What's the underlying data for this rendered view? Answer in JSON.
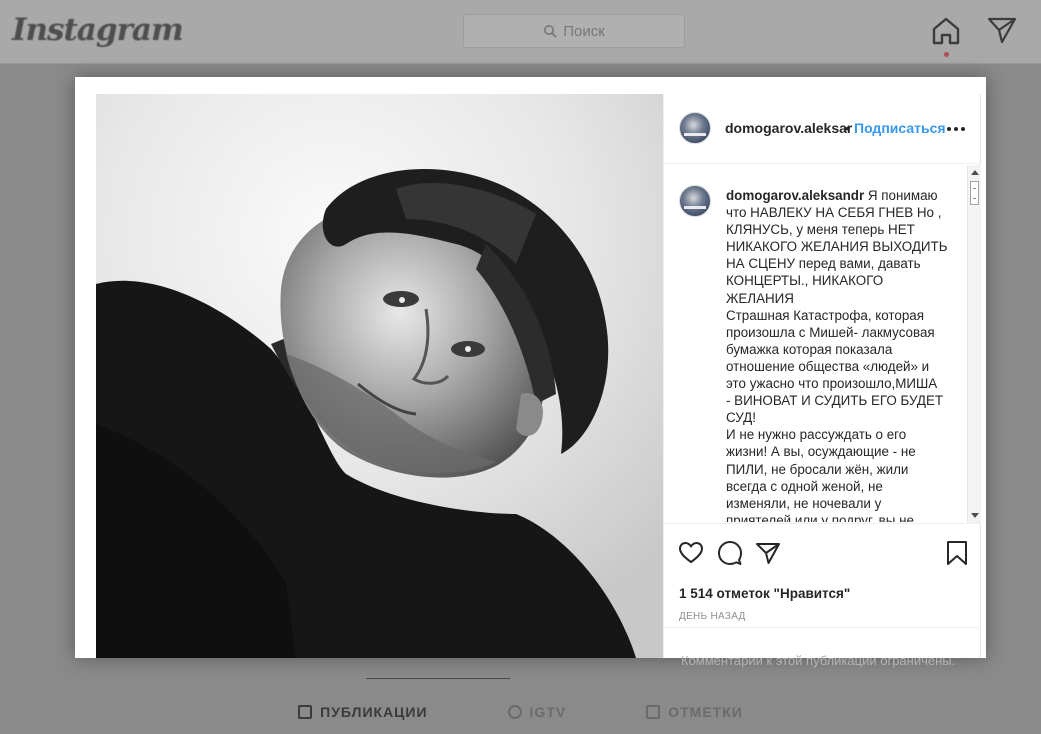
{
  "background": {
    "logo": "Instagram",
    "search_placeholder": "Поиск",
    "tabs": [
      {
        "label": "ПУБЛИКАЦИИ"
      },
      {
        "label": "IGTV"
      },
      {
        "label": "ОТМЕТКИ"
      }
    ]
  },
  "post": {
    "header": {
      "username": "domogarov.aleksar",
      "dot": "•",
      "follow_label": "Подписаться"
    },
    "caption": {
      "username": "domogarov.aleksandr",
      "lines": [
        "Я понимаю",
        "что НАВЛЕКУ НА СЕБЯ ГНЕВ Но ,",
        "КЛЯНУСЬ, у меня теперь НЕТ",
        "НИКАКОГО ЖЕЛАНИЯ ВЫХОДИТЬ",
        "НА СЦЕНУ перед вами, давать",
        "КОНЦЕРТЫ., НИКАКОГО",
        "ЖЕЛАНИЯ",
        "Страшная Катастрофа, которая",
        "произошла с Мишей- лакмусовая",
        "бумажка которая показала",
        "отношение общества «людей» и",
        "это ужасно что произошло,МИША",
        "- ВИНОВАТ И СУДИТЬ ЕГО БУДЕТ",
        "СУД!",
        "И не нужно рассуждать о его",
        "жизни! А вы, осуждающие - не",
        "ПИЛИ, не бросали жён, жили",
        "всегда с одной женой, не",
        "изменяли, не ночевали у",
        "приятелей или у подруг, вы не"
      ]
    },
    "likes": "1 514 отметок \"Нравится\"",
    "date": "ДЕНЬ НАЗАД",
    "comments_notice": "Комментарии к этой публикации ограничены."
  },
  "icons": {
    "header": [
      "search-icon",
      "home-icon",
      "direct-icon"
    ],
    "actions": [
      "heart-icon",
      "comment-icon",
      "share-icon",
      "bookmark-icon"
    ]
  },
  "colors": {
    "link": "#3897f0",
    "text": "#262626",
    "muted": "#8e8e8e",
    "overlay": "#8e8e8e"
  }
}
